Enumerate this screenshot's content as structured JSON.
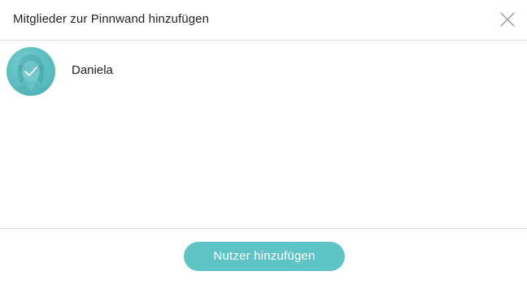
{
  "dialog": {
    "title": "Mitglieder zur Pinnwand hinzufügen",
    "close_icon": "close-icon"
  },
  "members": [
    {
      "name": "Daniela",
      "selected": true,
      "avatar_icon": "user-avatar",
      "check_icon": "checkmark-icon"
    }
  ],
  "footer": {
    "add_button_label": "Nutzer hinzufügen"
  },
  "colors": {
    "accent": "#5fc4c6",
    "divider": "#dcdcdc",
    "text": "#1f1f1f"
  }
}
